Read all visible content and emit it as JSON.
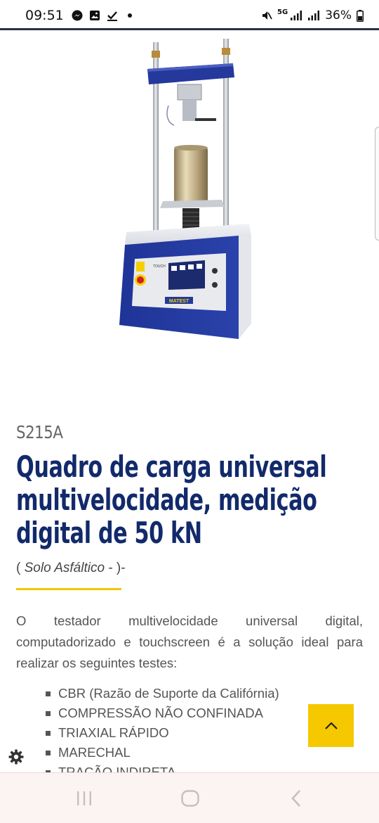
{
  "status_bar": {
    "time": "09:51",
    "battery": "36%",
    "network": "5G"
  },
  "product": {
    "code": "S215A",
    "title": "Quadro de carga universal multivelocidade, medição digital de 50 kN",
    "category_open": "(",
    "category_name": "Solo Asfáltico",
    "category_close": "- )-",
    "image_brand": "MATEST",
    "image_panel_label": "TOUCH"
  },
  "description": {
    "line1_words": [
      "O",
      "testador",
      "multivelocidade",
      "universal",
      "digital,"
    ],
    "rest": "computadorizado e touchscreen é a solução ideal para realizar os seguintes testes:"
  },
  "tests": [
    "CBR (Razão de Suporte da Califórnia)",
    "COMPRESSÃO NÃO CONFINADA",
    "TRIAXIAL RÁPIDO",
    "MARECHAL",
    "TRAÇÃO INDIRETA"
  ],
  "colors": {
    "title": "#122a6b",
    "accent_yellow": "#f2c500",
    "machine_blue": "#24399a"
  }
}
